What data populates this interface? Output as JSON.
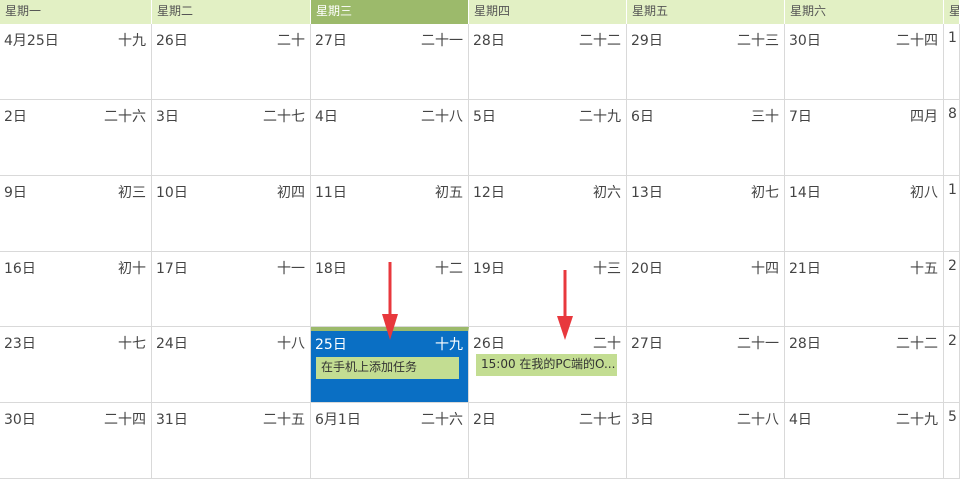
{
  "weekdays": [
    {
      "label": "星期一",
      "active": false
    },
    {
      "label": "星期二",
      "active": false
    },
    {
      "label": "星期三",
      "active": true
    },
    {
      "label": "星期四",
      "active": false
    },
    {
      "label": "星期五",
      "active": false
    },
    {
      "label": "星期六",
      "active": false
    },
    {
      "label": "星",
      "active": false
    }
  ],
  "weeks": [
    [
      {
        "day": "4月25日",
        "lunar": "十九"
      },
      {
        "day": "26日",
        "lunar": "二十"
      },
      {
        "day": "27日",
        "lunar": "二十一"
      },
      {
        "day": "28日",
        "lunar": "二十二"
      },
      {
        "day": "29日",
        "lunar": "二十三"
      },
      {
        "day": "30日",
        "lunar": "二十四"
      },
      {
        "day": "1",
        "lunar": ""
      }
    ],
    [
      {
        "day": "2日",
        "lunar": "二十六"
      },
      {
        "day": "3日",
        "lunar": "二十七"
      },
      {
        "day": "4日",
        "lunar": "二十八"
      },
      {
        "day": "5日",
        "lunar": "二十九"
      },
      {
        "day": "6日",
        "lunar": "三十"
      },
      {
        "day": "7日",
        "lunar": "四月"
      },
      {
        "day": "8",
        "lunar": ""
      }
    ],
    [
      {
        "day": "9日",
        "lunar": "初三"
      },
      {
        "day": "10日",
        "lunar": "初四"
      },
      {
        "day": "11日",
        "lunar": "初五"
      },
      {
        "day": "12日",
        "lunar": "初六"
      },
      {
        "day": "13日",
        "lunar": "初七"
      },
      {
        "day": "14日",
        "lunar": "初八"
      },
      {
        "day": "1",
        "lunar": ""
      }
    ],
    [
      {
        "day": "16日",
        "lunar": "初十"
      },
      {
        "day": "17日",
        "lunar": "十一"
      },
      {
        "day": "18日",
        "lunar": "十二"
      },
      {
        "day": "19日",
        "lunar": "十三"
      },
      {
        "day": "20日",
        "lunar": "十四"
      },
      {
        "day": "21日",
        "lunar": "十五"
      },
      {
        "day": "2",
        "lunar": ""
      }
    ],
    [
      {
        "day": "23日",
        "lunar": "十七"
      },
      {
        "day": "24日",
        "lunar": "十八"
      },
      {
        "day": "25日",
        "lunar": "十九",
        "selected": true,
        "event": "在手机上添加任务"
      },
      {
        "day": "26日",
        "lunar": "二十",
        "event": "15:00 在我的PC端的O..."
      },
      {
        "day": "27日",
        "lunar": "二十一"
      },
      {
        "day": "28日",
        "lunar": "二十二"
      },
      {
        "day": "2",
        "lunar": ""
      }
    ],
    [
      {
        "day": "30日",
        "lunar": "二十四"
      },
      {
        "day": "31日",
        "lunar": "二十五"
      },
      {
        "day": "6月1日",
        "lunar": "二十六"
      },
      {
        "day": "2日",
        "lunar": "二十七"
      },
      {
        "day": "3日",
        "lunar": "二十八"
      },
      {
        "day": "4日",
        "lunar": "二十九"
      },
      {
        "day": "5",
        "lunar": ""
      }
    ]
  ],
  "colors": {
    "header_bg": "#e2f0c4",
    "header_active": "#9cba6b",
    "selected_bg": "#0a6fc4",
    "event_bg": "#c3dd92",
    "arrow": "#e8383d"
  },
  "annotations": [
    {
      "name": "red-arrow-icon"
    },
    {
      "name": "red-arrow-icon"
    }
  ]
}
